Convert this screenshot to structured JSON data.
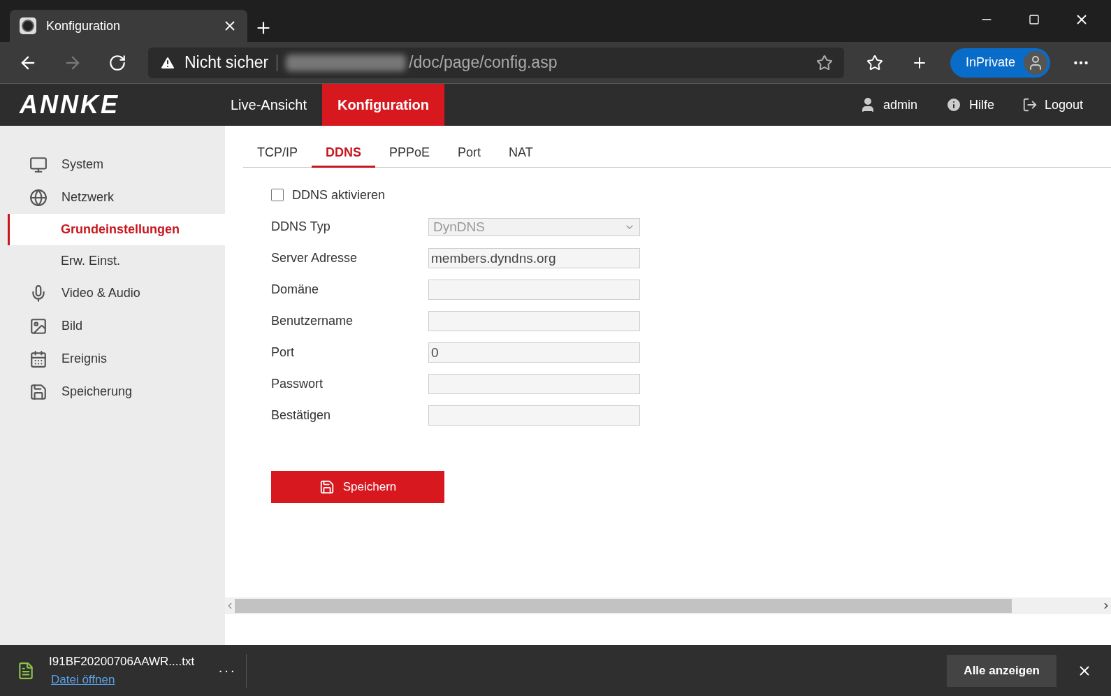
{
  "browser": {
    "tab": {
      "title": "Konfiguration"
    },
    "address": {
      "security": "Nicht sicher",
      "path": "/doc/page/config.asp"
    },
    "profile": {
      "label": "InPrivate"
    }
  },
  "header": {
    "logo": "ANNKE",
    "nav": [
      {
        "label": "Live-Ansicht",
        "selected": false
      },
      {
        "label": "Konfiguration",
        "selected": true
      }
    ],
    "user": "admin",
    "help": "Hilfe",
    "logout": "Logout"
  },
  "sidebar": {
    "items": [
      {
        "label": "System",
        "selected": false
      },
      {
        "label": "Netzwerk",
        "selected": false,
        "children": [
          {
            "label": "Grundeinstellungen",
            "selected": true
          },
          {
            "label": "Erw. Einst.",
            "selected": false
          }
        ]
      },
      {
        "label": "Video & Audio",
        "selected": false
      },
      {
        "label": "Bild",
        "selected": false
      },
      {
        "label": "Ereignis",
        "selected": false
      },
      {
        "label": "Speicherung",
        "selected": false
      }
    ]
  },
  "tabs": [
    {
      "label": "TCP/IP",
      "selected": false
    },
    {
      "label": "DDNS",
      "selected": true
    },
    {
      "label": "PPPoE",
      "selected": false
    },
    {
      "label": "Port",
      "selected": false
    },
    {
      "label": "NAT",
      "selected": false
    }
  ],
  "form": {
    "enable": {
      "label": "DDNS aktivieren",
      "checked": false
    },
    "fields": [
      {
        "kind": "select",
        "label": "DDNS Typ",
        "value": "DynDNS",
        "disabled": true
      },
      {
        "kind": "text",
        "label": "Server Adresse",
        "value": "members.dyndns.org"
      },
      {
        "kind": "text",
        "label": "Domäne"
      },
      {
        "kind": "text",
        "label": "Benutzername"
      },
      {
        "kind": "text",
        "label": "Port",
        "value": "0"
      },
      {
        "kind": "password",
        "label": "Passwort"
      },
      {
        "kind": "password",
        "label": "Bestätigen"
      }
    ],
    "save": "Speichern"
  },
  "downloads": {
    "file": "I91BF20200706AAWR....txt",
    "action": "Datei öffnen",
    "more": "···",
    "show_all": "Alle anzeigen"
  }
}
